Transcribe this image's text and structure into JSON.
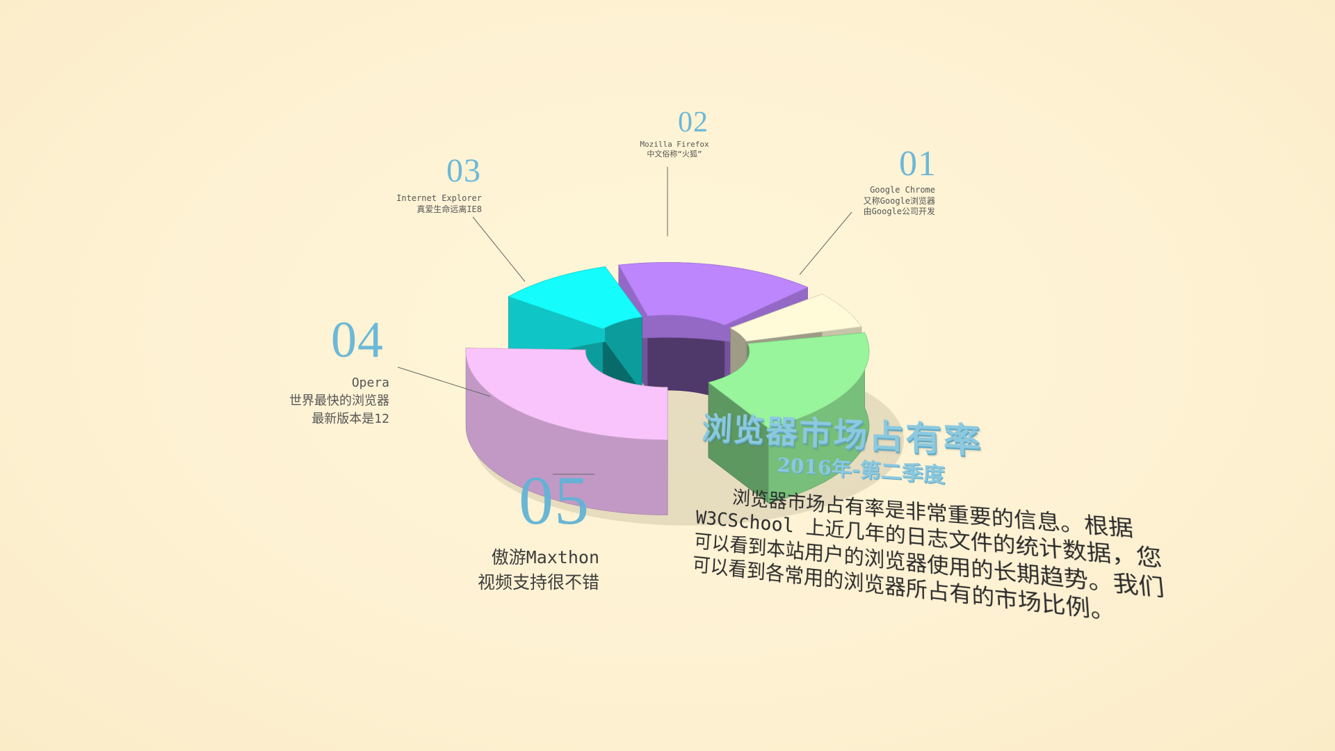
{
  "chart_data": {
    "type": "pie",
    "style": "3d-donut",
    "slices": [
      {
        "rank": "01",
        "name": "Google Chrome",
        "lines": [
          "Google Chrome",
          "又称Google浏览器",
          "由Google公司开发"
        ],
        "color": "#98f59c",
        "start": -12,
        "end": 60,
        "rel_value": 72
      },
      {
        "rank": "02",
        "name": "Mozilla Firefox",
        "lines": [
          "Mozilla Firefox",
          "中文俗称“火狐”"
        ],
        "color": "#fffbd9",
        "start": -40,
        "end": -16,
        "rel_value": 24
      },
      {
        "rank": "03",
        "name": "Internet Explorer",
        "lines": [
          "Internet Explorer",
          "真爱生命远离IE8"
        ],
        "color": "#bd86fc",
        "start": -104,
        "end": -46,
        "rel_value": 58
      },
      {
        "rank": "04",
        "name": "Opera",
        "lines": [
          "Opera",
          "世界最快的浏览器",
          "最新版本是12"
        ],
        "color": "#15fcfc",
        "start": -142,
        "end": -108,
        "rel_value": 34
      },
      {
        "rank": "05",
        "name": "傲游Maxthon",
        "lines": [
          "傲游Maxthon",
          "视频支持很不错"
        ],
        "color": "#f9c4fc",
        "start": 90,
        "end": 182,
        "rel_value": 92
      }
    ]
  },
  "title": "浏览器市场占有率",
  "subtitle": "2016年-第二季度",
  "description": "浏览器市场占有率是非常重要的信息。根据 W3CSchool 上近几年的日志文件的统计数据，您可以看到本站用户的浏览器使用的长期趋势。我们可以看到各常用的浏览器所占有的市场比例。"
}
